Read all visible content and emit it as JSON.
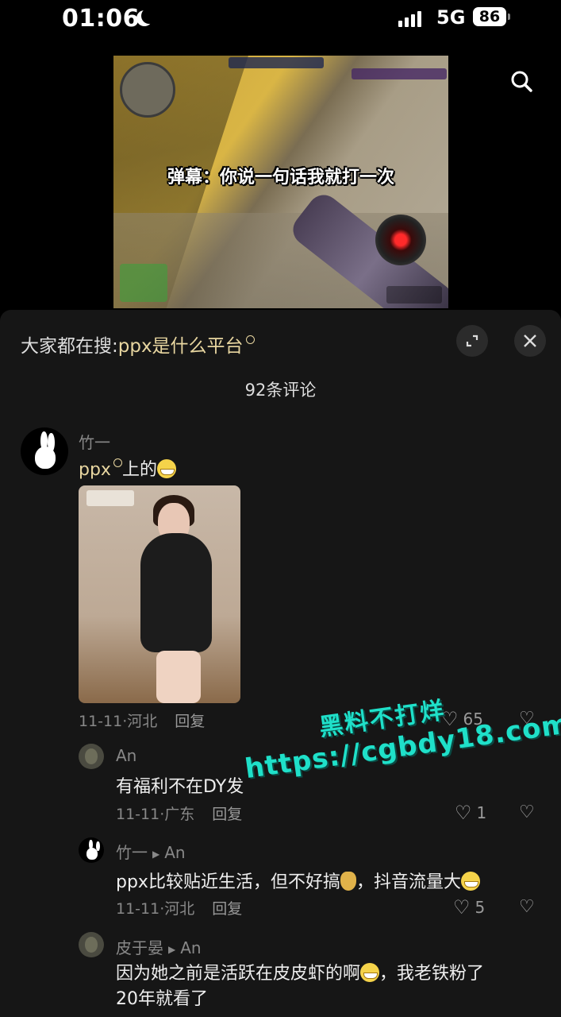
{
  "status_bar": {
    "time": "01:06",
    "network": "5G",
    "battery": "86"
  },
  "video": {
    "caption": "弹幕：你说一句话我就打一次"
  },
  "panel": {
    "hot_search_prefix": "大家都在搜:",
    "hot_search_keyword": "ppx是什么平台",
    "comment_count": "92条评论"
  },
  "comments": [
    {
      "user": "竹一",
      "text_keyword": "ppx",
      "text_rest": "上的",
      "date": "11-11",
      "location": "河北",
      "reply_label": "回复",
      "likes": "65"
    },
    {
      "user": "An",
      "text": "有福利不在DY发",
      "date": "11-11",
      "location": "广东",
      "reply_label": "回复",
      "likes": "1"
    },
    {
      "user": "竹一",
      "reply_to": "An",
      "text_a": "ppx比较贴近生活，但不好搞",
      "text_b": "，抖音流量大",
      "date": "11-11",
      "location": "河北",
      "reply_label": "回复",
      "likes": "5"
    },
    {
      "user": "皮于晏",
      "reply_to": "An",
      "text_a": "因为她之前是活跃在皮皮虾的啊",
      "text_b": "，我老铁粉了",
      "text_c": "20年就看了"
    }
  ],
  "watermark": {
    "line1": "黑料不打烊",
    "line2": "https://cgbdy18.com"
  }
}
